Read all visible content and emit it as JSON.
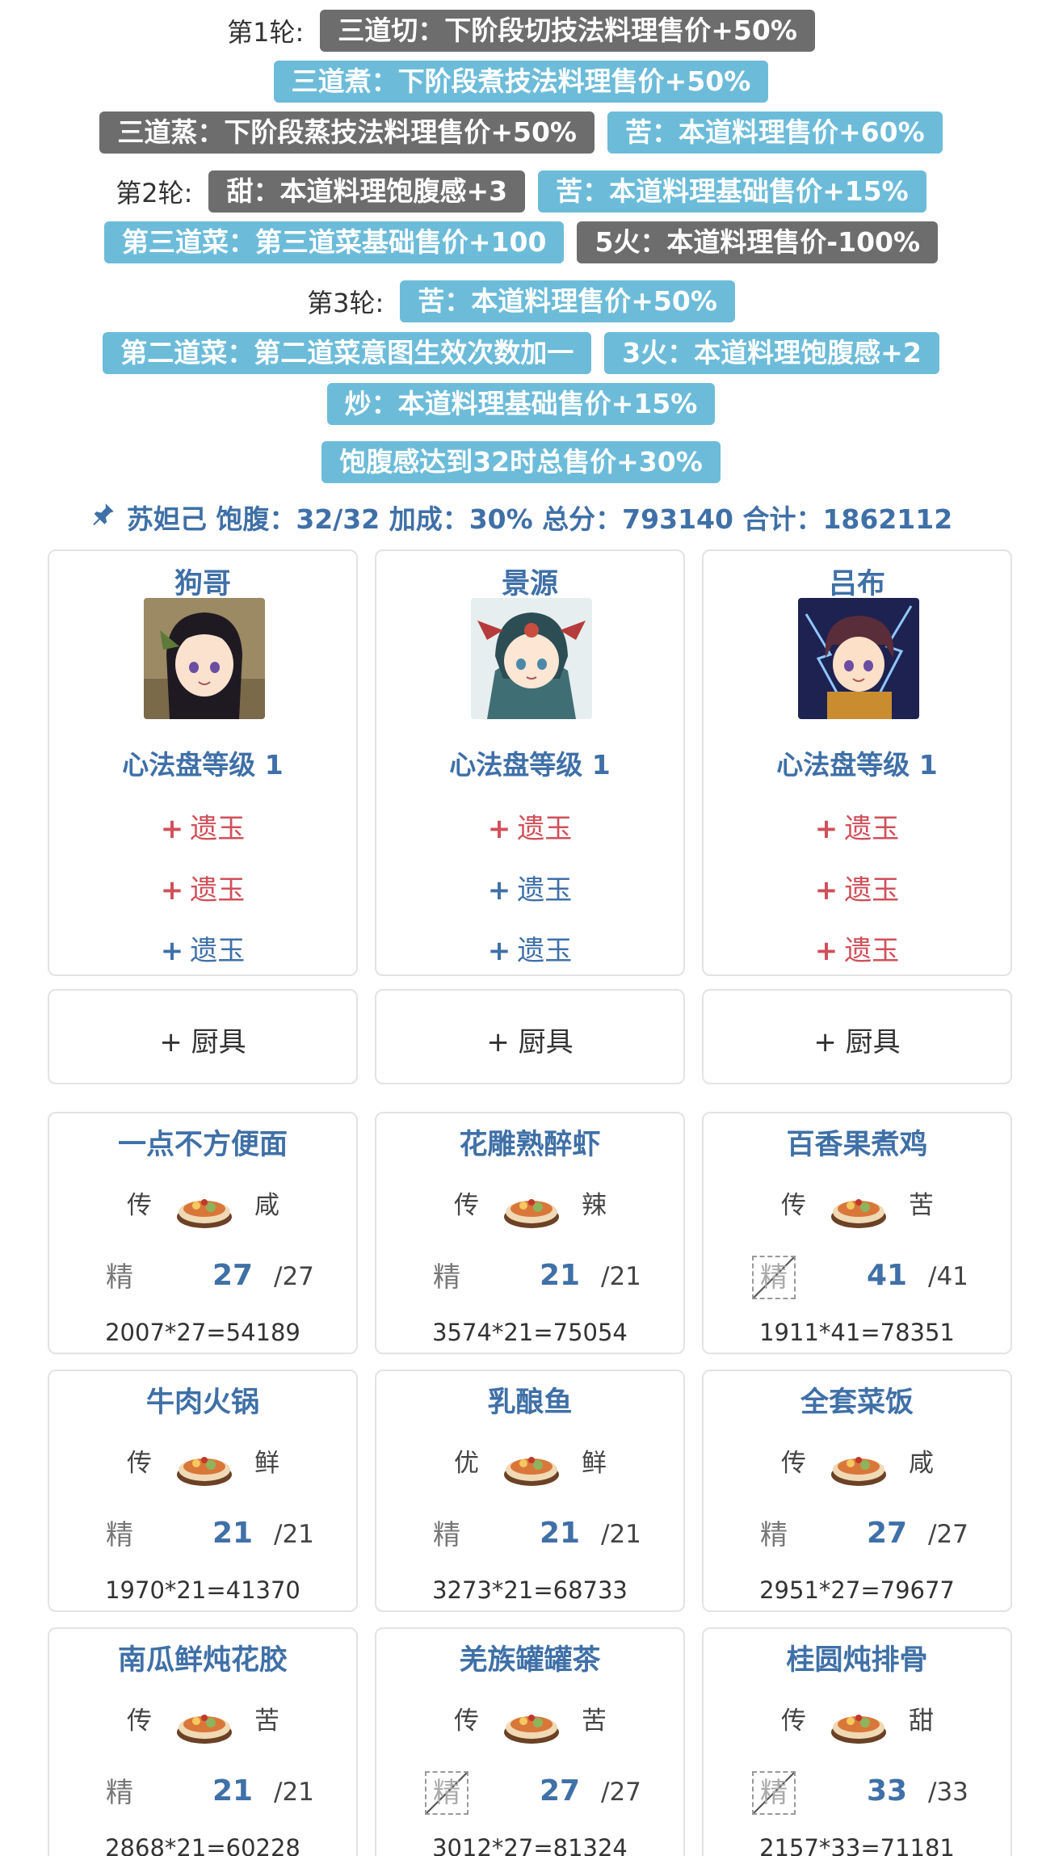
{
  "rounds": [
    {
      "label": "第1轮:"
    },
    {
      "label": "第2轮:"
    },
    {
      "label": "第3轮:"
    }
  ],
  "rules": {
    "r1": [
      "三道切：下阶段切技法料理售价+50%",
      "三道煮：下阶段煮技法料理售价+50%",
      "三道蒸：下阶段蒸技法料理售价+50%",
      "苦：本道料理售价+60%"
    ],
    "r2": [
      "甜：本道料理饱腹感+3",
      "苦：本道料理基础售价+15%",
      "第三道菜：第三道菜基础售价+100",
      "5火：本道料理售价-100%"
    ],
    "r3": [
      "苦：本道料理售价+50%",
      "第二道菜：第二道菜意图生效次数加一",
      "3火：本道料理饱腹感+2",
      "炒：本道料理基础售价+15%"
    ],
    "extra": "饱腹感达到32时总售价+30%"
  },
  "summary": {
    "text": "苏妲己 饱腹：32/32 加成：30% 总分：793140 合计：1862112",
    "icon": "pin-icon"
  },
  "colors": {
    "accent": "#3f70a7",
    "tag_blue": "#6cbcd9",
    "tag_gray": "#6d6d6d",
    "red": "#d0505a"
  },
  "chefs": [
    {
      "name": "狗哥",
      "heart_level": "心法盘等级 1",
      "jade": [
        {
          "plus": "+",
          "label": "遗玉",
          "color": "red"
        },
        {
          "plus": "+",
          "label": "遗玉",
          "color": "red"
        },
        {
          "plus": "+",
          "label": "遗玉",
          "color": "blue"
        }
      ],
      "tool": "+ 厨具",
      "dishes": [
        {
          "name": "一点不方便面",
          "rank": "传",
          "taste": "咸",
          "skill": "精",
          "qty": "27",
          "max": "/27",
          "formula": "2007*27=54189",
          "skill_dashed": false
        },
        {
          "name": "牛肉火锅",
          "rank": "传",
          "taste": "鲜",
          "skill": "精",
          "qty": "21",
          "max": "/21",
          "formula": "1970*21=41370",
          "skill_dashed": false
        },
        {
          "name": "南瓜鲜炖花胶",
          "rank": "传",
          "taste": "苦",
          "skill": "精",
          "qty": "21",
          "max": "/21",
          "formula": "2868*21=60228",
          "skill_dashed": false
        }
      ]
    },
    {
      "name": "景源",
      "heart_level": "心法盘等级 1",
      "jade": [
        {
          "plus": "+",
          "label": "遗玉",
          "color": "red"
        },
        {
          "plus": "+",
          "label": "遗玉",
          "color": "blue"
        },
        {
          "plus": "+",
          "label": "遗玉",
          "color": "blue"
        }
      ],
      "tool": "+ 厨具",
      "dishes": [
        {
          "name": "花雕熟醉虾",
          "rank": "传",
          "taste": "辣",
          "skill": "精",
          "qty": "21",
          "max": "/21",
          "formula": "3574*21=75054",
          "skill_dashed": false
        },
        {
          "name": "乳酿鱼",
          "rank": "优",
          "taste": "鲜",
          "skill": "精",
          "qty": "21",
          "max": "/21",
          "formula": "3273*21=68733",
          "skill_dashed": false
        },
        {
          "name": "羌族罐罐茶",
          "rank": "传",
          "taste": "苦",
          "skill": "精",
          "qty": "27",
          "max": "/27",
          "formula": "3012*27=81324",
          "skill_dashed": true
        }
      ]
    },
    {
      "name": "吕布",
      "heart_level": "心法盘等级 1",
      "jade": [
        {
          "plus": "+",
          "label": "遗玉",
          "color": "red"
        },
        {
          "plus": "+",
          "label": "遗玉",
          "color": "red"
        },
        {
          "plus": "+",
          "label": "遗玉",
          "color": "red"
        }
      ],
      "tool": "+ 厨具",
      "dishes": [
        {
          "name": "百香果煮鸡",
          "rank": "传",
          "taste": "苦",
          "skill": "精",
          "qty": "41",
          "max": "/41",
          "formula": "1911*41=78351",
          "skill_dashed": true
        },
        {
          "name": "全套菜饭",
          "rank": "传",
          "taste": "咸",
          "skill": "精",
          "qty": "27",
          "max": "/27",
          "formula": "2951*27=79677",
          "skill_dashed": false
        },
        {
          "name": "桂圆炖排骨",
          "rank": "传",
          "taste": "甜",
          "skill": "精",
          "qty": "33",
          "max": "/33",
          "formula": "2157*33=71181",
          "skill_dashed": true
        }
      ]
    }
  ]
}
